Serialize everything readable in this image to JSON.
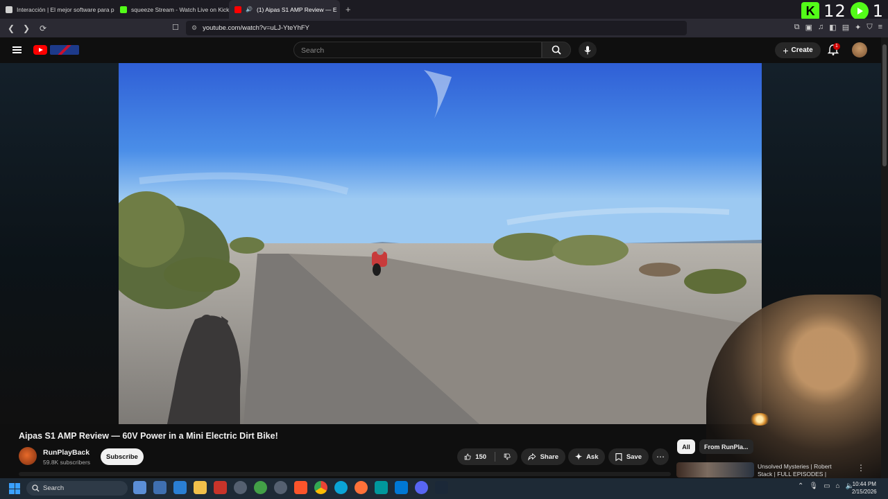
{
  "browser": {
    "tabs": [
      {
        "title": "Interacción | El mejor software para p",
        "active": false,
        "favicon_color": "#d0d0d0"
      },
      {
        "title": "squeeze Stream - Watch Live on Kick",
        "active": false,
        "favicon_color": "#53fc18"
      },
      {
        "title": "(1) Aipas S1 AMP Review — E",
        "active": true,
        "favicon_color": "#ff0000"
      }
    ],
    "url": "youtube.com/watch?v=uLJ-YteYhFY",
    "kick_overlay": {
      "viewers": "12",
      "count_right": "1"
    }
  },
  "youtube": {
    "search_placeholder": "Search",
    "create_label": "Create",
    "notification_count": "1",
    "video": {
      "title": "Aipas S1 AMP Review — 60V Power in a Mini Electric Dirt Bike!",
      "channel": "RunPlayBack",
      "subscribers": "59.8K subscribers",
      "subscribe_label": "Subscribe",
      "likes": "150",
      "share_label": "Share",
      "ask_label": "Ask",
      "save_label": "Save"
    },
    "chips": {
      "all": "All",
      "from": "From RunPla..."
    },
    "recommendation": {
      "title": "Unsolved Mysteries | Robert Stack | FULL EPISODES |"
    }
  },
  "taskbar": {
    "search_label": "Search",
    "time": "10:44 PM",
    "date": "2/15/2026"
  },
  "colors": {
    "youtube_red": "#ff0000",
    "kick_green": "#53fc18",
    "bg": "#0f0f0f"
  }
}
